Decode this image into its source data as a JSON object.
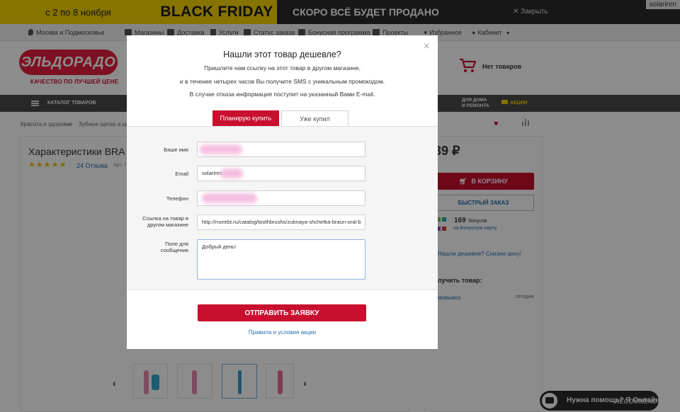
{
  "promo": {
    "dates": "с 2 по 8 ноября",
    "black_friday": "BLACK FRIDAY",
    "soon": "СКОРО ВСЁ БУДЕТ ПРОДАНО",
    "close": "✕ Закрыть",
    "user": "solariren"
  },
  "topbar": {
    "region": "Москва и Подмосковье",
    "stores": "Магазины",
    "delivery": "Доставка",
    "services": "Услуги",
    "order_status": "Статус заказа",
    "bonus": "Бонусная программа",
    "projects": "Проекты",
    "favorites": "Избранное",
    "cabinet": "Кабинет"
  },
  "header": {
    "logo": "ЭЛЬДОРАДО",
    "slogan": "КАЧЕСТВО ПО ЛУЧШЕЙ ЦЕНЕ",
    "cart": "Нет товаров"
  },
  "nav": {
    "catalog": "КАТАЛОГ ТОВАРОВ",
    "home_line1": "ДЛЯ ДОМА",
    "home_line2": "И РЕМОНТА",
    "sale": "АКЦИИ"
  },
  "breadcrumbs": [
    "Красота и здоровье",
    "Зубные щетки и цент"
  ],
  "product": {
    "title": "Характеристики BRA",
    "stars": "★★★★★",
    "reviews": "24 Отзыва",
    "art": "Арт. 7",
    "price": "39 ₽",
    "to_cart": "В КОРЗИНУ",
    "quick_order": "БЫСТРЫЙ ЗАКАЗ",
    "bonus_count": "169",
    "bonus_word": "бонусов",
    "bonus_card_prefix": "на",
    "bonus_card_link": "Бонусную карту",
    "cheaper_link": "Нашли дешевле? Снизим цену!",
    "get_title": "лучить товар:",
    "self_pickup": "мовывоз",
    "today": "сегодня"
  },
  "help": {
    "label": "Нужна помощь? Я Онлайн",
    "watermark": "RECOMMEND.RU"
  },
  "modal": {
    "close": "×",
    "title": "Нашли этот товар дешевле?",
    "text1": "Пришлите нам ссылку на этот товар в другом магазине,",
    "text2": "и в течение четырех часов Вы получите SMS с уникальным промокодом.",
    "text3": "В случае отказа информация поступит на указанный Вами E-mail.",
    "tab_active": "Планирую купить",
    "tab_inactive": "Уже купил",
    "fields": {
      "name_label": "Ваше имя",
      "name_value": "",
      "email_label": "Email",
      "email_value": "solariren",
      "phone_label": "Телефон",
      "phone_value": "",
      "link_label_1": "Ссылка на товар в",
      "link_label_2": "другом магазине",
      "link_value": "http://morebt.ru/catalog/toothbrushs/zubnaya-shchetka-braun-oral-b",
      "message_label_1": "Поле для",
      "message_label_2": "сообщения",
      "message_value": "Добрый день!"
    },
    "submit": "ОТПРАВИТЬ ЗАЯВКУ",
    "rules": "Правила и условия акции"
  },
  "colors": {
    "accent_red": "#c8102e",
    "promo_yellow": "#f5d100",
    "link_blue": "#2a6db0",
    "overlay": "rgba(0,0,0,0.45)"
  },
  "icons": [
    "location-icon",
    "store-icon",
    "truck-icon",
    "tools-icon",
    "order-icon",
    "percent-icon",
    "projects-icon",
    "heart-icon",
    "user-icon",
    "cart-icon",
    "close-icon",
    "chevron-left-icon",
    "chevron-right-icon",
    "chat-icon"
  ]
}
